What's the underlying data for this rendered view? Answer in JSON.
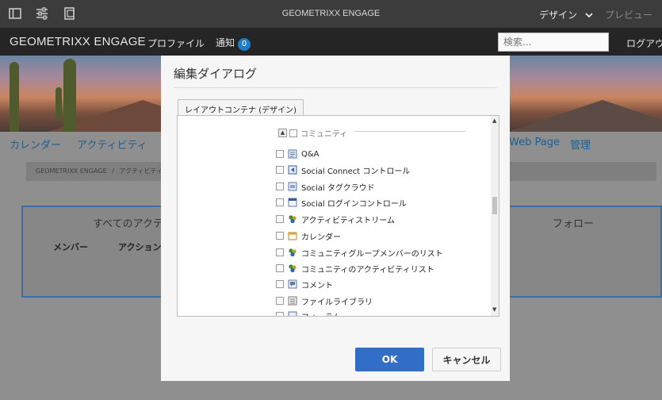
{
  "editor_toolbar": {
    "title": "GEOMETRIXX ENGAGE",
    "mode_label": "デザイン",
    "preview_label": "プレビュー",
    "icons": [
      "sidepanel-icon",
      "properties-icon",
      "emulator-icon"
    ]
  },
  "site_nav": {
    "logo": "GEOMETRIXX ENGAGE",
    "profile_label": "プロファイル",
    "notifications_label": "通知",
    "notifications_count": "0",
    "search_placeholder": "検索...",
    "logout_label": "ログアウ"
  },
  "page": {
    "nav": {
      "calendar": "カレンダー",
      "activity": "アクティビティ",
      "webpage": "Web Page",
      "admin": "管理"
    },
    "breadcrumb": [
      "GEOMETRIXX ENGAGE",
      "/",
      "アクティビティ"
    ],
    "follow_panel": {
      "left_title": "すべてのアクティ",
      "right_title": "フォロー",
      "col_member": "メンバー",
      "col_action": "アクション"
    }
  },
  "dialog": {
    "title": "編集ダイアログ",
    "tab_label": "レイアウトコンテナ (デザイン)",
    "group_label": "コミュニティ",
    "items": [
      {
        "label": "Q&A",
        "icon": "qa-icon"
      },
      {
        "label": "Social Connect コントロール",
        "icon": "social-connect-icon"
      },
      {
        "label": "Social タグクラウド",
        "icon": "tag-cloud-icon"
      },
      {
        "label": "Social ログインコントロール",
        "icon": "login-control-icon"
      },
      {
        "label": "アクティビティストリーム",
        "icon": "activity-stream-icon"
      },
      {
        "label": "カレンダー",
        "icon": "calendar-icon"
      },
      {
        "label": "コミュニティグループメンバーのリスト",
        "icon": "group-members-icon"
      },
      {
        "label": "コミュニティのアクティビティリスト",
        "icon": "activity-list-icon"
      },
      {
        "label": "コメント",
        "icon": "comment-icon"
      },
      {
        "label": "ファイルライブラリ",
        "icon": "file-library-icon"
      },
      {
        "label": "フォーラム",
        "icon": "forum-icon"
      }
    ],
    "ok_label": "OK",
    "cancel_label": "キャンセル"
  },
  "colors": {
    "accent": "#326ec8",
    "badge": "#1c7fc4",
    "link": "#1c5f92"
  }
}
